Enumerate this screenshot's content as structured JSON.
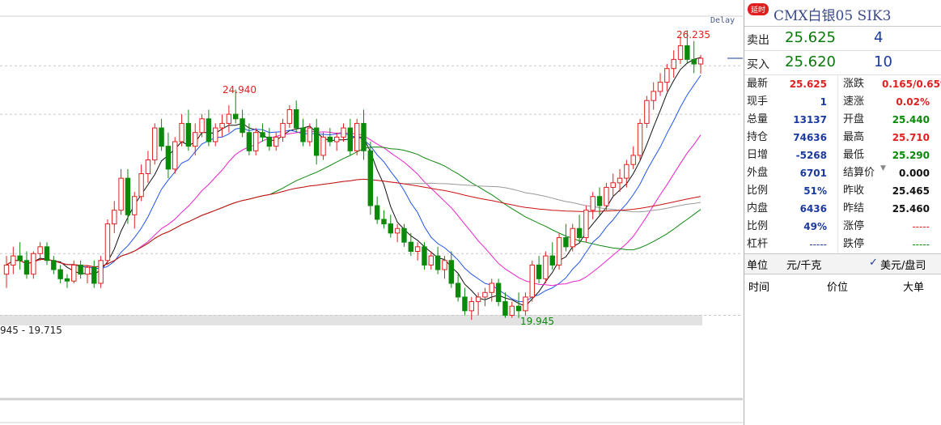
{
  "chart_data": {
    "type": "candlestick",
    "annotations": {
      "high_label": "26.235",
      "mid_label": "24.940",
      "low_label": "19.945",
      "range_label": "945 - 19.715"
    },
    "ohlc": [
      [
        20.9,
        21.3,
        20.6,
        21.1
      ],
      [
        21.1,
        21.5,
        20.9,
        21.3
      ],
      [
        21.3,
        21.6,
        21.0,
        21.2
      ],
      [
        21.2,
        21.4,
        20.8,
        20.9
      ],
      [
        20.9,
        21.4,
        20.8,
        21.35
      ],
      [
        21.35,
        21.6,
        21.2,
        21.5
      ],
      [
        21.5,
        21.6,
        21.1,
        21.2
      ],
      [
        21.2,
        21.3,
        20.9,
        21.0
      ],
      [
        21.0,
        21.1,
        20.7,
        20.8
      ],
      [
        20.8,
        20.9,
        20.6,
        20.75
      ],
      [
        20.75,
        21.2,
        20.7,
        21.1
      ],
      [
        21.1,
        21.2,
        20.8,
        20.9
      ],
      [
        20.9,
        21.1,
        20.7,
        21.05
      ],
      [
        21.05,
        21.2,
        20.6,
        20.7
      ],
      [
        20.7,
        21.3,
        20.6,
        21.2
      ],
      [
        21.2,
        22.1,
        21.1,
        22.0
      ],
      [
        22.0,
        22.5,
        21.8,
        22.3
      ],
      [
        22.3,
        23.2,
        22.2,
        23.0
      ],
      [
        23.0,
        23.2,
        22.0,
        22.2
      ],
      [
        22.2,
        22.7,
        21.9,
        22.6
      ],
      [
        22.6,
        23.3,
        22.5,
        23.1
      ],
      [
        23.1,
        23.6,
        22.9,
        23.4
      ],
      [
        23.4,
        24.2,
        23.3,
        24.1
      ],
      [
        24.1,
        24.3,
        23.6,
        23.7
      ],
      [
        23.7,
        24.0,
        23.0,
        23.2
      ],
      [
        23.2,
        23.9,
        23.1,
        23.8
      ],
      [
        23.8,
        24.4,
        23.7,
        24.2
      ],
      [
        24.2,
        24.5,
        23.6,
        23.7
      ],
      [
        23.7,
        24.2,
        23.5,
        24.0
      ],
      [
        24.0,
        24.4,
        23.9,
        24.3
      ],
      [
        24.3,
        24.5,
        23.7,
        23.8
      ],
      [
        23.8,
        24.2,
        23.7,
        24.1
      ],
      [
        24.1,
        24.4,
        23.9,
        24.2
      ],
      [
        24.2,
        24.6,
        24.0,
        24.4
      ],
      [
        24.4,
        24.94,
        24.2,
        24.3
      ],
      [
        24.3,
        24.5,
        23.9,
        24.0
      ],
      [
        24.0,
        24.2,
        23.5,
        23.6
      ],
      [
        23.6,
        24.1,
        23.5,
        24.0
      ],
      [
        24.0,
        24.2,
        23.8,
        23.9
      ],
      [
        23.9,
        24.1,
        23.6,
        23.7
      ],
      [
        23.7,
        24.0,
        23.6,
        23.9
      ],
      [
        23.9,
        24.3,
        23.8,
        24.2
      ],
      [
        24.2,
        24.6,
        24.1,
        24.5
      ],
      [
        24.5,
        24.7,
        24.0,
        24.1
      ],
      [
        24.1,
        24.3,
        23.7,
        23.8
      ],
      [
        23.8,
        24.2,
        23.7,
        24.1
      ],
      [
        24.1,
        24.3,
        23.3,
        23.5
      ],
      [
        23.5,
        24.0,
        23.4,
        23.9
      ],
      [
        23.9,
        24.1,
        23.7,
        23.8
      ],
      [
        23.8,
        24.0,
        23.6,
        23.9
      ],
      [
        23.9,
        24.2,
        23.8,
        24.1
      ],
      [
        24.1,
        24.3,
        23.5,
        23.6
      ],
      [
        23.6,
        24.3,
        23.5,
        24.2
      ],
      [
        24.2,
        24.5,
        23.4,
        23.6
      ],
      [
        23.6,
        23.8,
        22.2,
        22.4
      ],
      [
        22.4,
        22.6,
        22.0,
        22.1
      ],
      [
        22.1,
        22.3,
        21.9,
        22.0
      ],
      [
        22.0,
        22.2,
        21.7,
        21.8
      ],
      [
        21.8,
        22.0,
        21.6,
        21.9
      ],
      [
        21.9,
        22.0,
        21.5,
        21.6
      ],
      [
        21.6,
        21.8,
        21.3,
        21.4
      ],
      [
        21.4,
        21.6,
        21.2,
        21.5
      ],
      [
        21.5,
        21.6,
        21.0,
        21.1
      ],
      [
        21.1,
        21.4,
        21.0,
        21.3
      ],
      [
        21.3,
        21.5,
        20.9,
        21.0
      ],
      [
        21.0,
        21.3,
        20.8,
        21.2
      ],
      [
        21.2,
        21.4,
        20.6,
        20.7
      ],
      [
        20.7,
        20.9,
        20.3,
        20.4
      ],
      [
        20.4,
        20.6,
        20.0,
        20.1
      ],
      [
        20.1,
        20.4,
        19.9,
        20.3
      ],
      [
        20.3,
        20.5,
        20.0,
        20.4
      ],
      [
        20.4,
        20.6,
        20.2,
        20.5
      ],
      [
        20.5,
        20.8,
        20.3,
        20.7
      ],
      [
        20.7,
        20.8,
        20.2,
        20.3
      ],
      [
        20.3,
        20.5,
        19.945,
        20.0
      ],
      [
        20.0,
        20.3,
        19.945,
        20.2
      ],
      [
        20.2,
        20.5,
        19.945,
        20.1
      ],
      [
        20.1,
        20.5,
        20.0,
        20.4
      ],
      [
        20.4,
        21.2,
        20.3,
        21.1
      ],
      [
        21.1,
        21.3,
        20.7,
        20.8
      ],
      [
        20.8,
        21.4,
        20.7,
        21.3
      ],
      [
        21.3,
        21.6,
        21.0,
        21.1
      ],
      [
        21.1,
        21.8,
        21.0,
        21.7
      ],
      [
        21.7,
        22.0,
        21.4,
        21.5
      ],
      [
        21.5,
        22.0,
        21.4,
        21.9
      ],
      [
        21.9,
        22.2,
        21.6,
        21.7
      ],
      [
        21.7,
        22.4,
        21.6,
        22.3
      ],
      [
        22.3,
        22.7,
        22.1,
        22.6
      ],
      [
        22.6,
        22.8,
        22.2,
        22.4
      ],
      [
        22.4,
        22.9,
        22.3,
        22.8
      ],
      [
        22.8,
        23.1,
        22.6,
        22.9
      ],
      [
        22.9,
        23.2,
        22.7,
        23.0
      ],
      [
        23.0,
        23.4,
        22.8,
        23.3
      ],
      [
        23.3,
        23.7,
        23.2,
        23.5
      ],
      [
        23.5,
        24.3,
        23.4,
        24.2
      ],
      [
        24.2,
        24.8,
        24.1,
        24.7
      ],
      [
        24.7,
        25.1,
        24.5,
        24.9
      ],
      [
        24.9,
        25.3,
        24.8,
        25.1
      ],
      [
        25.1,
        25.5,
        24.9,
        25.4
      ],
      [
        25.4,
        25.8,
        25.2,
        25.6
      ],
      [
        25.6,
        26.1,
        25.5,
        25.9
      ],
      [
        25.9,
        26.235,
        25.5,
        25.6
      ],
      [
        25.6,
        26.0,
        25.3,
        25.5
      ],
      [
        25.5,
        25.7,
        25.29,
        25.625
      ]
    ],
    "grid_y_values": [
      25.46,
      24.4,
      21.35,
      20.0
    ],
    "ylim": [
      17.6,
      26.9
    ]
  },
  "chart": {
    "delay_label": "Delay"
  },
  "panel": {
    "badge": "延时",
    "title": "CMX白银05 SIK3",
    "sell": {
      "label": "卖出",
      "price": "25.625",
      "qty": "4"
    },
    "buy": {
      "label": "买入",
      "price": "25.620",
      "qty": "10"
    },
    "rows": [
      {
        "k1": "最新",
        "v1": "25.625",
        "c1": "red",
        "k2": "涨跌",
        "v2": "0.165/0.65%",
        "c2": "red"
      },
      {
        "k1": "现手",
        "v1": "1",
        "c1": "blue",
        "k2": "速涨",
        "v2": "0.02%",
        "c2": "red"
      },
      {
        "k1": "总量",
        "v1": "13137",
        "c1": "blue",
        "k2": "开盘",
        "v2": "25.440",
        "c2": "green"
      },
      {
        "k1": "持仓",
        "v1": "74636",
        "c1": "blue",
        "k2": "最高",
        "v2": "25.710",
        "c2": "red"
      },
      {
        "k1": "日增",
        "v1": "-5268",
        "c1": "blue",
        "k2": "最低",
        "v2": "25.290",
        "c2": "green"
      },
      {
        "k1": "外盘",
        "v1": "6701",
        "c1": "blue",
        "k2": "结算价",
        "v2": "0.000",
        "c2": "black"
      },
      {
        "k1": "比例",
        "v1": "51%",
        "c1": "blue",
        "k2": "昨收",
        "v2": "25.465",
        "c2": "black"
      },
      {
        "k1": "内盘",
        "v1": "6436",
        "c1": "blue",
        "k2": "昨结",
        "v2": "25.460",
        "c2": "black"
      },
      {
        "k1": "比例",
        "v1": "49%",
        "c1": "blue",
        "k2": "涨停",
        "v2": "-----",
        "c2": "dash"
      },
      {
        "k1": "杠杆",
        "v1": "-----",
        "c1": "dashb",
        "k2": "跌停",
        "v2": "-----",
        "c2": "dashg"
      }
    ],
    "unit": {
      "label": "单位",
      "value": "元/千克",
      "check": "✓",
      "alt": "美元/盘司"
    },
    "ticks_header": {
      "time": "时间",
      "price": "价位",
      "big": "大单"
    }
  }
}
